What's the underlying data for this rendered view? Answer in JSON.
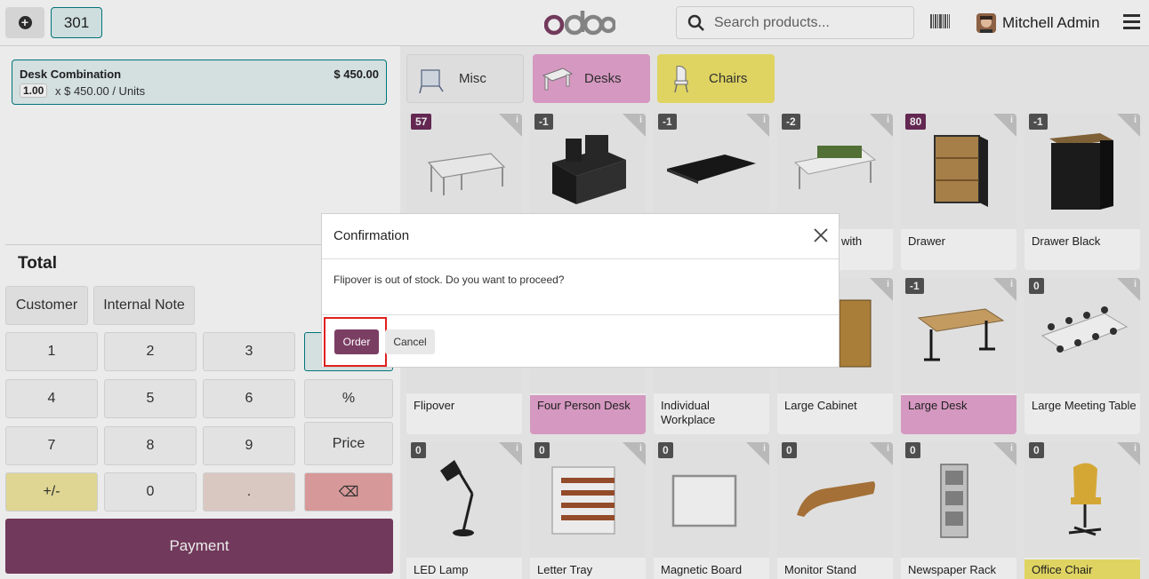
{
  "header": {
    "order_number": "301",
    "logo_text": "odoo",
    "search_placeholder": "Search products...",
    "user_name": "Mitchell Admin"
  },
  "order": {
    "line": {
      "name": "Desk Combination",
      "price": "$ 450.00",
      "qty": "1.00",
      "unit_text": "x $ 450.00 / Units"
    },
    "total_label": "Total",
    "total_value": "$"
  },
  "controls": {
    "customer": "Customer",
    "internal_note": "Internal Note"
  },
  "numpad": {
    "keys": [
      "1",
      "2",
      "3",
      "4",
      "5",
      "6",
      "%",
      "7",
      "8",
      "9",
      "Price",
      "+/-",
      "0",
      ".",
      "⌫"
    ],
    "payment": "Payment"
  },
  "categories": [
    {
      "label": "Misc",
      "color": "#f0f0f0"
    },
    {
      "label": "Desks",
      "color": "#e8a5d1"
    },
    {
      "label": "Chairs",
      "color": "#f2e66b"
    }
  ],
  "products": [
    {
      "name": "",
      "stock": "57",
      "positive": true
    },
    {
      "name": "",
      "stock": "-1",
      "positive": false
    },
    {
      "name": "",
      "stock": "-1",
      "positive": false
    },
    {
      "name": "with",
      "stock": "-2",
      "positive": false
    },
    {
      "name": "Drawer",
      "stock": "80",
      "positive": true
    },
    {
      "name": "Drawer Black",
      "stock": "-1",
      "positive": false
    },
    {
      "name": "Flipover",
      "stock": "",
      "positive": false
    },
    {
      "name": "Four Person Desk",
      "stock": "",
      "positive": false,
      "hl": "pink"
    },
    {
      "name": "Individual Workplace",
      "stock": "",
      "positive": false
    },
    {
      "name": "Large Cabinet",
      "stock": "",
      "positive": false
    },
    {
      "name": "Large Desk",
      "stock": "-1",
      "positive": false,
      "hl": "pink"
    },
    {
      "name": "Large Meeting Table",
      "stock": "0",
      "positive": false
    },
    {
      "name": "LED Lamp",
      "stock": "0",
      "positive": false
    },
    {
      "name": "Letter Tray",
      "stock": "0",
      "positive": false
    },
    {
      "name": "Magnetic Board",
      "stock": "0",
      "positive": false
    },
    {
      "name": "Monitor Stand",
      "stock": "0",
      "positive": false
    },
    {
      "name": "Newspaper Rack",
      "stock": "0",
      "positive": false
    },
    {
      "name": "Office Chair",
      "stock": "0",
      "positive": false,
      "hl": "yellow"
    }
  ],
  "dialog": {
    "title": "Confirmation",
    "message": "Flipover is out of stock. Do you want to proceed?",
    "order_button": "Order",
    "cancel_button": "Cancel"
  },
  "colors": {
    "brand": "#7b3e63",
    "teal": "#017e84"
  }
}
